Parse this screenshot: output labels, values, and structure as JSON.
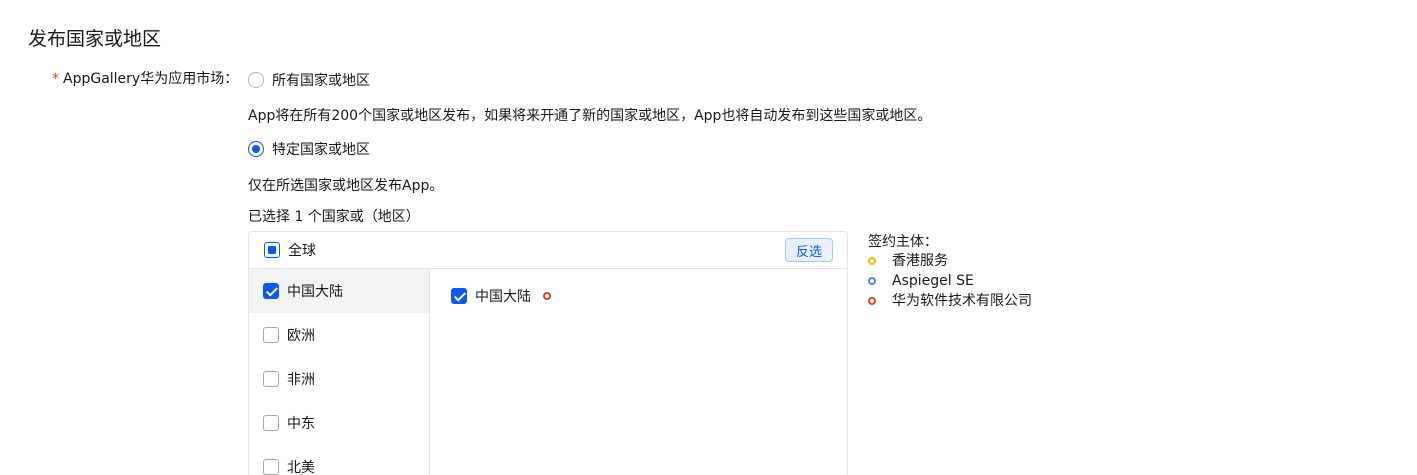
{
  "section": {
    "title": "发布国家或地区"
  },
  "field": {
    "required_mark": "*",
    "label": "AppGallery华为应用市场："
  },
  "options": {
    "all": {
      "label": "所有国家或地区",
      "description": "App将在所有200个国家或地区发布，如果将来开通了新的国家或地区，App也将自动发布到这些国家或地区。",
      "selected": false
    },
    "specific": {
      "label": "特定国家或地区",
      "description": "仅在所选国家或地区发布App。",
      "selected": true
    }
  },
  "selection_count": "已选择 1 个国家或（地区）",
  "panel": {
    "global": {
      "label": "全球",
      "state": "partial"
    },
    "invert_label": "反选",
    "regions": [
      {
        "label": "中国大陆",
        "checked": true,
        "active": true
      },
      {
        "label": "欧洲",
        "checked": false,
        "active": false
      },
      {
        "label": "非洲",
        "checked": false,
        "active": false
      },
      {
        "label": "中东",
        "checked": false,
        "active": false
      },
      {
        "label": "北美",
        "checked": false,
        "active": false
      }
    ],
    "countries": [
      {
        "label": "中国大陆",
        "checked": true,
        "entity_color": "#e84026"
      }
    ]
  },
  "legend": {
    "title": "签约主体：",
    "items": [
      {
        "label": "香港服务",
        "color": "#f5b800"
      },
      {
        "label": "Aspiegel SE",
        "color": "#4a90e2"
      },
      {
        "label": "华为软件技术有限公司",
        "color": "#e84026"
      }
    ]
  }
}
